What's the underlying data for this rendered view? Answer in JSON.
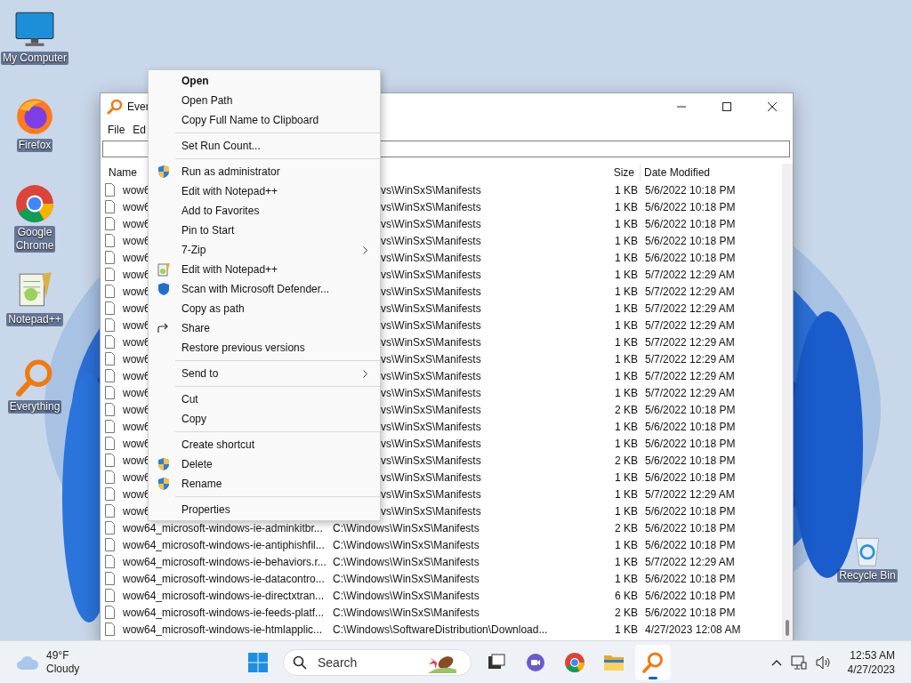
{
  "desktop_icons": [
    {
      "label": "My Computer",
      "kind": "computer"
    },
    {
      "label": "Firefox",
      "kind": "firefox"
    },
    {
      "label": "Google\nChrome",
      "kind": "chrome"
    },
    {
      "label": "Notepad++",
      "kind": "notepad"
    },
    {
      "label": "Everything",
      "kind": "everything"
    },
    {
      "label": "Recycle Bin",
      "kind": "recycle"
    }
  ],
  "window": {
    "title": "Ever",
    "menu": [
      "File",
      "Ed"
    ],
    "columns": [
      {
        "label": "Name"
      },
      {
        "label": "Size"
      },
      {
        "label": "Date Modified"
      }
    ],
    "rows": [
      {
        "name": "wow6",
        "path": "vs\\WinSxS\\Manifests",
        "under_menu": true,
        "size": "1 KB",
        "date": "5/6/2022 10:18 PM"
      },
      {
        "name": "wow6",
        "path": "vs\\WinSxS\\Manifests",
        "under_menu": true,
        "size": "1 KB",
        "date": "5/6/2022 10:18 PM"
      },
      {
        "name": "wow6",
        "path": "vs\\WinSxS\\Manifests",
        "under_menu": true,
        "size": "1 KB",
        "date": "5/6/2022 10:18 PM"
      },
      {
        "name": "wow6",
        "path": "vs\\WinSxS\\Manifests",
        "under_menu": true,
        "size": "1 KB",
        "date": "5/6/2022 10:18 PM"
      },
      {
        "name": "wow6",
        "path": "vs\\WinSxS\\Manifests",
        "under_menu": true,
        "size": "1 KB",
        "date": "5/6/2022 10:18 PM"
      },
      {
        "name": "wow6",
        "path": "vs\\WinSxS\\Manifests",
        "under_menu": true,
        "size": "1 KB",
        "date": "5/7/2022 12:29 AM"
      },
      {
        "name": "wow6",
        "path": "vs\\WinSxS\\Manifests",
        "under_menu": true,
        "size": "1 KB",
        "date": "5/7/2022 12:29 AM"
      },
      {
        "name": "wow6",
        "path": "vs\\WinSxS\\Manifests",
        "under_menu": true,
        "size": "1 KB",
        "date": "5/7/2022 12:29 AM"
      },
      {
        "name": "wow6",
        "path": "vs\\WinSxS\\Manifests",
        "under_menu": true,
        "size": "1 KB",
        "date": "5/7/2022 12:29 AM"
      },
      {
        "name": "wow6",
        "path": "vs\\WinSxS\\Manifests",
        "under_menu": true,
        "size": "1 KB",
        "date": "5/7/2022 12:29 AM"
      },
      {
        "name": "wow6",
        "path": "vs\\WinSxS\\Manifests",
        "under_menu": true,
        "size": "1 KB",
        "date": "5/7/2022 12:29 AM"
      },
      {
        "name": "wow6",
        "path": "vs\\WinSxS\\Manifests",
        "under_menu": true,
        "size": "1 KB",
        "date": "5/7/2022 12:29 AM"
      },
      {
        "name": "wow6",
        "path": "vs\\WinSxS\\Manifests",
        "under_menu": true,
        "size": "1 KB",
        "date": "5/7/2022 12:29 AM"
      },
      {
        "name": "wow6",
        "path": "vs\\WinSxS\\Manifests",
        "under_menu": true,
        "size": "2 KB",
        "date": "5/6/2022 10:18 PM"
      },
      {
        "name": "wow6",
        "path": "vs\\WinSxS\\Manifests",
        "under_menu": true,
        "size": "1 KB",
        "date": "5/6/2022 10:18 PM"
      },
      {
        "name": "wow6",
        "path": "vs\\WinSxS\\Manifests",
        "under_menu": true,
        "size": "1 KB",
        "date": "5/6/2022 10:18 PM"
      },
      {
        "name": "wow6",
        "path": "vs\\WinSxS\\Manifests",
        "under_menu": true,
        "size": "2 KB",
        "date": "5/6/2022 10:18 PM"
      },
      {
        "name": "wow6",
        "path": "vs\\WinSxS\\Manifests",
        "under_menu": true,
        "size": "1 KB",
        "date": "5/6/2022 10:18 PM"
      },
      {
        "name": "wow6",
        "path": "vs\\WinSxS\\Manifests",
        "under_menu": true,
        "size": "1 KB",
        "date": "5/7/2022 12:29 AM"
      },
      {
        "name": "wow6",
        "path": "vs\\WinSxS\\Manifests",
        "under_menu": true,
        "size": "1 KB",
        "date": "5/6/2022 10:18 PM"
      },
      {
        "name": "wow64_microsoft-windows-ie-adminkitbr...",
        "path": "C:\\Windows\\WinSxS\\Manifests",
        "under_menu": false,
        "size": "2 KB",
        "date": "5/6/2022 10:18 PM"
      },
      {
        "name": "wow64_microsoft-windows-ie-antiphishfil...",
        "path": "C:\\Windows\\WinSxS\\Manifests",
        "under_menu": false,
        "size": "1 KB",
        "date": "5/6/2022 10:18 PM"
      },
      {
        "name": "wow64_microsoft-windows-ie-behaviors.r...",
        "path": "C:\\Windows\\WinSxS\\Manifests",
        "under_menu": false,
        "size": "1 KB",
        "date": "5/7/2022 12:29 AM"
      },
      {
        "name": "wow64_microsoft-windows-ie-datacontro...",
        "path": "C:\\Windows\\WinSxS\\Manifests",
        "under_menu": false,
        "size": "1 KB",
        "date": "5/6/2022 10:18 PM"
      },
      {
        "name": "wow64_microsoft-windows-ie-directxtran...",
        "path": "C:\\Windows\\WinSxS\\Manifests",
        "under_menu": false,
        "size": "6 KB",
        "date": "5/6/2022 10:18 PM"
      },
      {
        "name": "wow64_microsoft-windows-ie-feeds-platf...",
        "path": "C:\\Windows\\WinSxS\\Manifests",
        "under_menu": false,
        "size": "2 KB",
        "date": "5/6/2022 10:18 PM"
      },
      {
        "name": "wow64_microsoft-windows-ie-htmlapplic...",
        "path": "C:\\Windows\\SoftwareDistribution\\Download...",
        "under_menu": false,
        "size": "1 KB",
        "date": "4/27/2023 12:08 AM"
      }
    ]
  },
  "context_menu": [
    {
      "kind": "item",
      "label": "Open",
      "default": true
    },
    {
      "kind": "item",
      "label": "Open Path",
      "default": false
    },
    {
      "kind": "item",
      "label": "Copy Full Name to Clipboard",
      "default": false
    },
    {
      "kind": "separator"
    },
    {
      "kind": "item",
      "label": "Set Run Count...",
      "default": false
    },
    {
      "kind": "separator"
    },
    {
      "kind": "shield",
      "label": "Run as administrator",
      "default": false
    },
    {
      "kind": "item",
      "label": "Edit with Notepad++",
      "default": false
    },
    {
      "kind": "item",
      "label": "Add to Favorites",
      "default": false
    },
    {
      "kind": "item",
      "label": "Pin to Start",
      "default": false
    },
    {
      "kind": "submenu",
      "label": "7-Zip",
      "default": false
    },
    {
      "kind": "notepad",
      "label": "Edit with Notepad++",
      "default": false
    },
    {
      "kind": "defender",
      "label": "Scan with Microsoft Defender...",
      "default": false
    },
    {
      "kind": "item",
      "label": "Copy as path",
      "default": false
    },
    {
      "kind": "share",
      "label": "Share",
      "default": false
    },
    {
      "kind": "item",
      "label": "Restore previous versions",
      "default": false
    },
    {
      "kind": "separator"
    },
    {
      "kind": "submenu",
      "label": "Send to",
      "default": false
    },
    {
      "kind": "separator"
    },
    {
      "kind": "item",
      "label": "Cut",
      "default": false
    },
    {
      "kind": "item",
      "label": "Copy",
      "default": false
    },
    {
      "kind": "separator"
    },
    {
      "kind": "item",
      "label": "Create shortcut",
      "default": false
    },
    {
      "kind": "shield",
      "label": "Delete",
      "default": false
    },
    {
      "kind": "shield",
      "label": "Rename",
      "default": false
    },
    {
      "kind": "separator"
    },
    {
      "kind": "item",
      "label": "Properties",
      "default": false
    }
  ],
  "taskbar": {
    "weather": {
      "temperature": "49°F",
      "condition": "Cloudy"
    },
    "search": {
      "placeholder": "Search"
    },
    "apps": [
      {
        "kind": "taskview",
        "selected": false
      },
      {
        "kind": "teams",
        "selected": false
      },
      {
        "kind": "chrome",
        "selected": false
      },
      {
        "kind": "explorer",
        "selected": false
      },
      {
        "kind": "everything",
        "selected": true
      }
    ],
    "time": "12:53 AM",
    "date": "4/27/2023"
  }
}
